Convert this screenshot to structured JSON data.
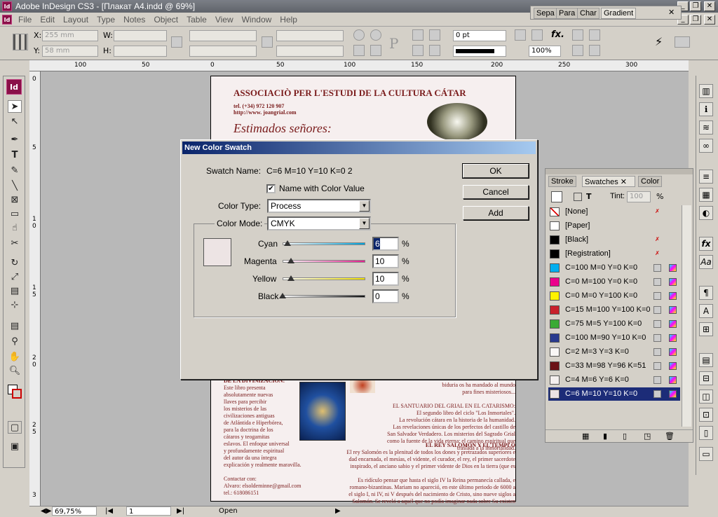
{
  "window": {
    "title": "Adobe InDesign CS3 - [Плакат A4.indd @ 69%]",
    "app_icon": "Id"
  },
  "menu": [
    "File",
    "Edit",
    "Layout",
    "Type",
    "Notes",
    "Object",
    "Table",
    "View",
    "Window",
    "Help"
  ],
  "control": {
    "x_label": "X:",
    "x_value": "255 mm",
    "y_label": "Y:",
    "y_value": "58 mm",
    "w_label": "W:",
    "h_label": "H:",
    "stroke_weight": "0 pt",
    "zoom": "100%",
    "P": "P"
  },
  "ruler": {
    "h_ticks": [
      "100",
      "50",
      "0",
      "50",
      "100",
      "150",
      "200",
      "250",
      "300"
    ],
    "v_ticks": [
      "0",
      "5",
      "1 0",
      "1 5",
      "2 0",
      "2 5",
      "3"
    ]
  },
  "top_tabs": [
    "Sepa",
    "Para",
    "Char",
    "Gradient"
  ],
  "page": {
    "heading": "ASSOCIACIÒ PER L'ESTUDI DE LA CULTURA CÁTAR",
    "tel": "tel. (+34) 972 120 907",
    "url": "http://www. joangrial.com",
    "greeting": "Estimados señores:",
    "left_col": [
      "DE LA DIVINIZACIÓN:",
      "Este libro presenta",
      "absolutamente nuevas",
      "llaves para percibir",
      "los misterios de las",
      "civilizaciones antiguas",
      "de Atlántida e Hiperbórea,",
      "para la doctrina de los",
      "cátaros y teogamitas",
      "eslavos. El enfoque universal",
      "y profundamente espiritual",
      "del autor da una íntegra",
      "explicación y realmente maravilla.",
      "",
      "Contactar con:",
      "Alvaro: elsoldeminne@gmail.com",
      "tel.: 618086151"
    ],
    "right_col": [
      "divinas de necesidad. La",
      "biduria os ha mandado al mundo",
      "para fines misteriosos...",
      "",
      "EL SANTUARIO DEL GRIAL EN EL CATARISMO:",
      "El segundo libro del ciclo \"Los Inmortales\".",
      "La revolución cátara en la historia de la humanidad.",
      "Las revelaciones únicas de los perfectos del castillo de",
      "San Salvador Verdadero. Los misterios del Sagrado Grial",
      "como la fuente de la vida eterna; el camino espiritual que",
      "traslada a la inmortalidad."
    ],
    "bottom": [
      "EL REY SALOMÓN Y EL TEMPLO",
      "El rey Salomón es la plenitud de todos los dones y pretrazados superiores e",
      "dad encarnada, el mesías, el vidente, el curador, el rey, el primer sacerdote",
      "inspirado, el anciano sabio y el primer vidente de Dios en la tierra (que es",
      "",
      "Es ridículo pensar que hasta el siglo IV la Reina permanecía callada, e",
      "romano-bizantinas. Mariam no apareció, en este último periodo de 6000 a",
      "el siglo I, ni IV, ni V después del nacimiento de Cristo, sino nueve siglos a",
      "Salomón. Se reveló a aquél que no podía imaginar nada sobre Su existen"
    ]
  },
  "dialog": {
    "title": "New Color Swatch",
    "swatch_name_label": "Swatch Name:",
    "swatch_name_value": "C=6 M=10 Y=10 K=0 2",
    "name_with_color_value": "Name with Color Value",
    "color_type_label": "Color Type:",
    "color_type_value": "Process",
    "color_mode_label": "Color Mode:",
    "color_mode_value": "CMYK",
    "preview_color": "#ede4e4",
    "sliders": [
      {
        "label": "Cyan",
        "value": "6",
        "colors": [
          "#ffffff",
          "#00a0d8"
        ]
      },
      {
        "label": "Magenta",
        "value": "10",
        "colors": [
          "#ffffff",
          "#e0208c"
        ]
      },
      {
        "label": "Yellow",
        "value": "10",
        "colors": [
          "#ffffff",
          "#f0e000"
        ]
      },
      {
        "label": "Black",
        "value": "0",
        "colors": [
          "#ffffff",
          "#101010"
        ]
      }
    ],
    "pct": "%",
    "ok": "OK",
    "cancel": "Cancel",
    "add": "Add"
  },
  "swatches": {
    "tabs": [
      "Stroke",
      "Swatches",
      "Color"
    ],
    "tint_label": "Tint:",
    "tint_value": "100",
    "tint_pct": "%",
    "items": [
      {
        "name": "[None]",
        "color": "#ffffff"
      },
      {
        "name": "[Paper]",
        "color": "#ffffff"
      },
      {
        "name": "[Black]",
        "color": "#000000"
      },
      {
        "name": "[Registration]",
        "color": "#000000"
      },
      {
        "name": "C=100 M=0 Y=0 K=0",
        "color": "#00aeef"
      },
      {
        "name": "C=0 M=100 Y=0 K=0",
        "color": "#ec008c"
      },
      {
        "name": "C=0 M=0 Y=100 K=0",
        "color": "#fff200"
      },
      {
        "name": "C=15 M=100 Y=100 K=0",
        "color": "#c8202c"
      },
      {
        "name": "C=75 M=5 Y=100 K=0",
        "color": "#3aaa35"
      },
      {
        "name": "C=100 M=90 Y=10 K=0",
        "color": "#293a8e"
      },
      {
        "name": "C=2 M=3 Y=3 K=0",
        "color": "#f9f7f6"
      },
      {
        "name": "C=33 M=98 Y=96 K=51",
        "color": "#6b1217"
      },
      {
        "name": "C=4 M=6 Y=6 K=0",
        "color": "#f4efee"
      },
      {
        "name": "C=6 M=10 Y=10 K=0",
        "color": "#ede4e4"
      }
    ]
  },
  "status": {
    "zoom": "69,75%",
    "page": "1",
    "state": "Open"
  }
}
